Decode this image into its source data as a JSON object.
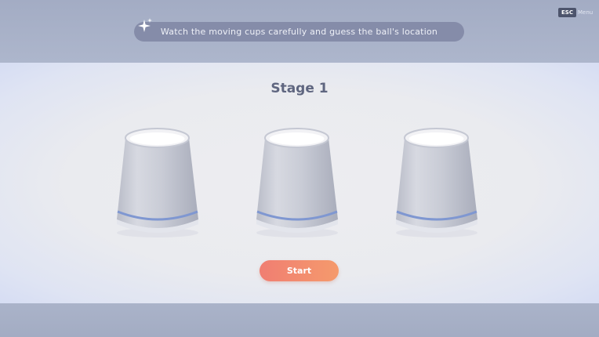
{
  "hud": {
    "instruction": "Watch the moving cups carefully and guess the ball's location",
    "esc_key": "ESC",
    "menu_label": "Menu"
  },
  "game": {
    "stage_title": "Stage 1",
    "start_label": "Start",
    "cups": [
      {
        "name": "cup-left"
      },
      {
        "name": "cup-middle"
      },
      {
        "name": "cup-right"
      }
    ]
  },
  "colors": {
    "accent_start_from": "#f07e72",
    "accent_start_to": "#f59a6c",
    "cup_stripe": "#7f97d1",
    "instruction_bar": "#858ca9"
  }
}
